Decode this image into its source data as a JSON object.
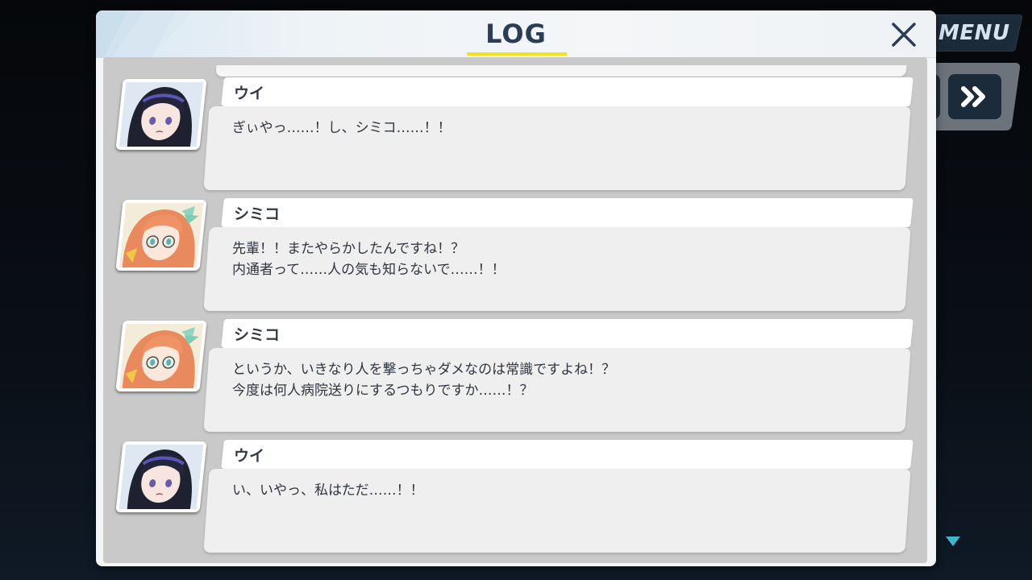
{
  "hud": {
    "menu_label": "MENU",
    "skip_icon": "fast-forward-icon",
    "scroll_icon": "triangle-down-icon"
  },
  "log": {
    "title": "LOG",
    "close_icon": "close-icon",
    "entries": [
      {
        "speaker": "ウイ",
        "portrait": "ui-portrait",
        "lines": [
          "ぎぃやっ……！し、シミコ……！！"
        ]
      },
      {
        "speaker": "シミコ",
        "portrait": "shimiko-portrait",
        "lines": [
          "先輩！！またやらかしたんですね！？",
          "内通者って……人の気も知らないで……！！"
        ]
      },
      {
        "speaker": "シミコ",
        "portrait": "shimiko-portrait",
        "lines": [
          "というか、いきなり人を撃っちゃダメなのは常識ですよね！？",
          "今度は何人病院送りにするつもりですか……！？"
        ]
      },
      {
        "speaker": "ウイ",
        "portrait": "ui-portrait",
        "lines": [
          "い、いやっ、私はただ……！！"
        ]
      }
    ]
  },
  "colors": {
    "title": "#2c3d55",
    "title_underline": "#f4e21c",
    "hud_button": "#1c2b3a",
    "scroll_indicator": "#3fb6c9"
  }
}
